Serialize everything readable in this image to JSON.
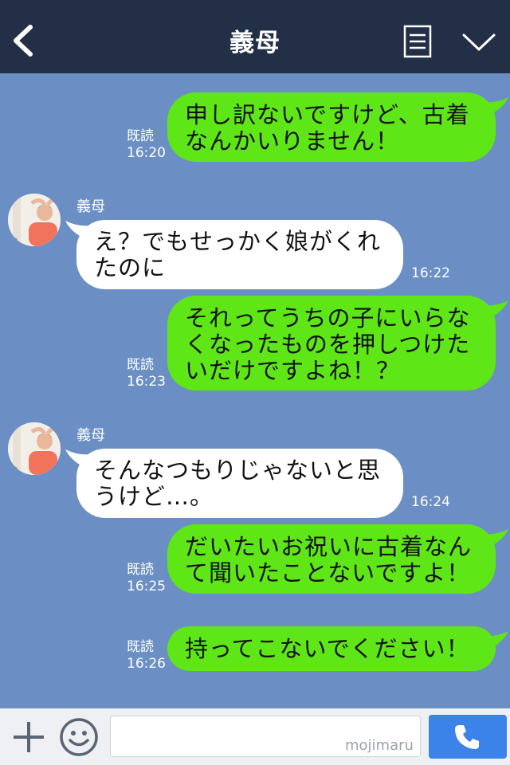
{
  "header": {
    "title": "義母",
    "back_icon": "chevron-left-icon",
    "menu_icon": "memo-icon",
    "collapse_icon": "chevron-down-icon"
  },
  "messages": [
    {
      "direction": "outgoing",
      "text": "申し訳ないですけど、古着\nなんかいりません！",
      "read": "既読",
      "time": "16:20"
    },
    {
      "direction": "incoming",
      "sender": "義母",
      "text": "え？でもせっかく娘がくれ\nたのに",
      "time": "16:22"
    },
    {
      "direction": "outgoing",
      "text": "それってうちの子にいらな\nくなったものを押しつけた\nいだけですよね！？",
      "read": "既読",
      "time": "16:23"
    },
    {
      "direction": "incoming",
      "sender": "義母",
      "text": "そんなつもりじゃないと思\nうけど…。",
      "time": "16:24"
    },
    {
      "direction": "outgoing",
      "text": "だいたいお祝いに古着なん\nて聞いたことないですよ！",
      "read": "既読",
      "time": "16:25"
    },
    {
      "direction": "outgoing",
      "text": "持ってこないでください！",
      "read": "既読",
      "time": "16:26"
    }
  ],
  "input": {
    "value": "",
    "watermark": "mojimaru"
  },
  "colors": {
    "background": "#6b8fc4",
    "header": "#232f46",
    "outgoing_bubble": "#5fe617",
    "incoming_bubble": "#ffffff",
    "call_button": "#3b83e8"
  }
}
